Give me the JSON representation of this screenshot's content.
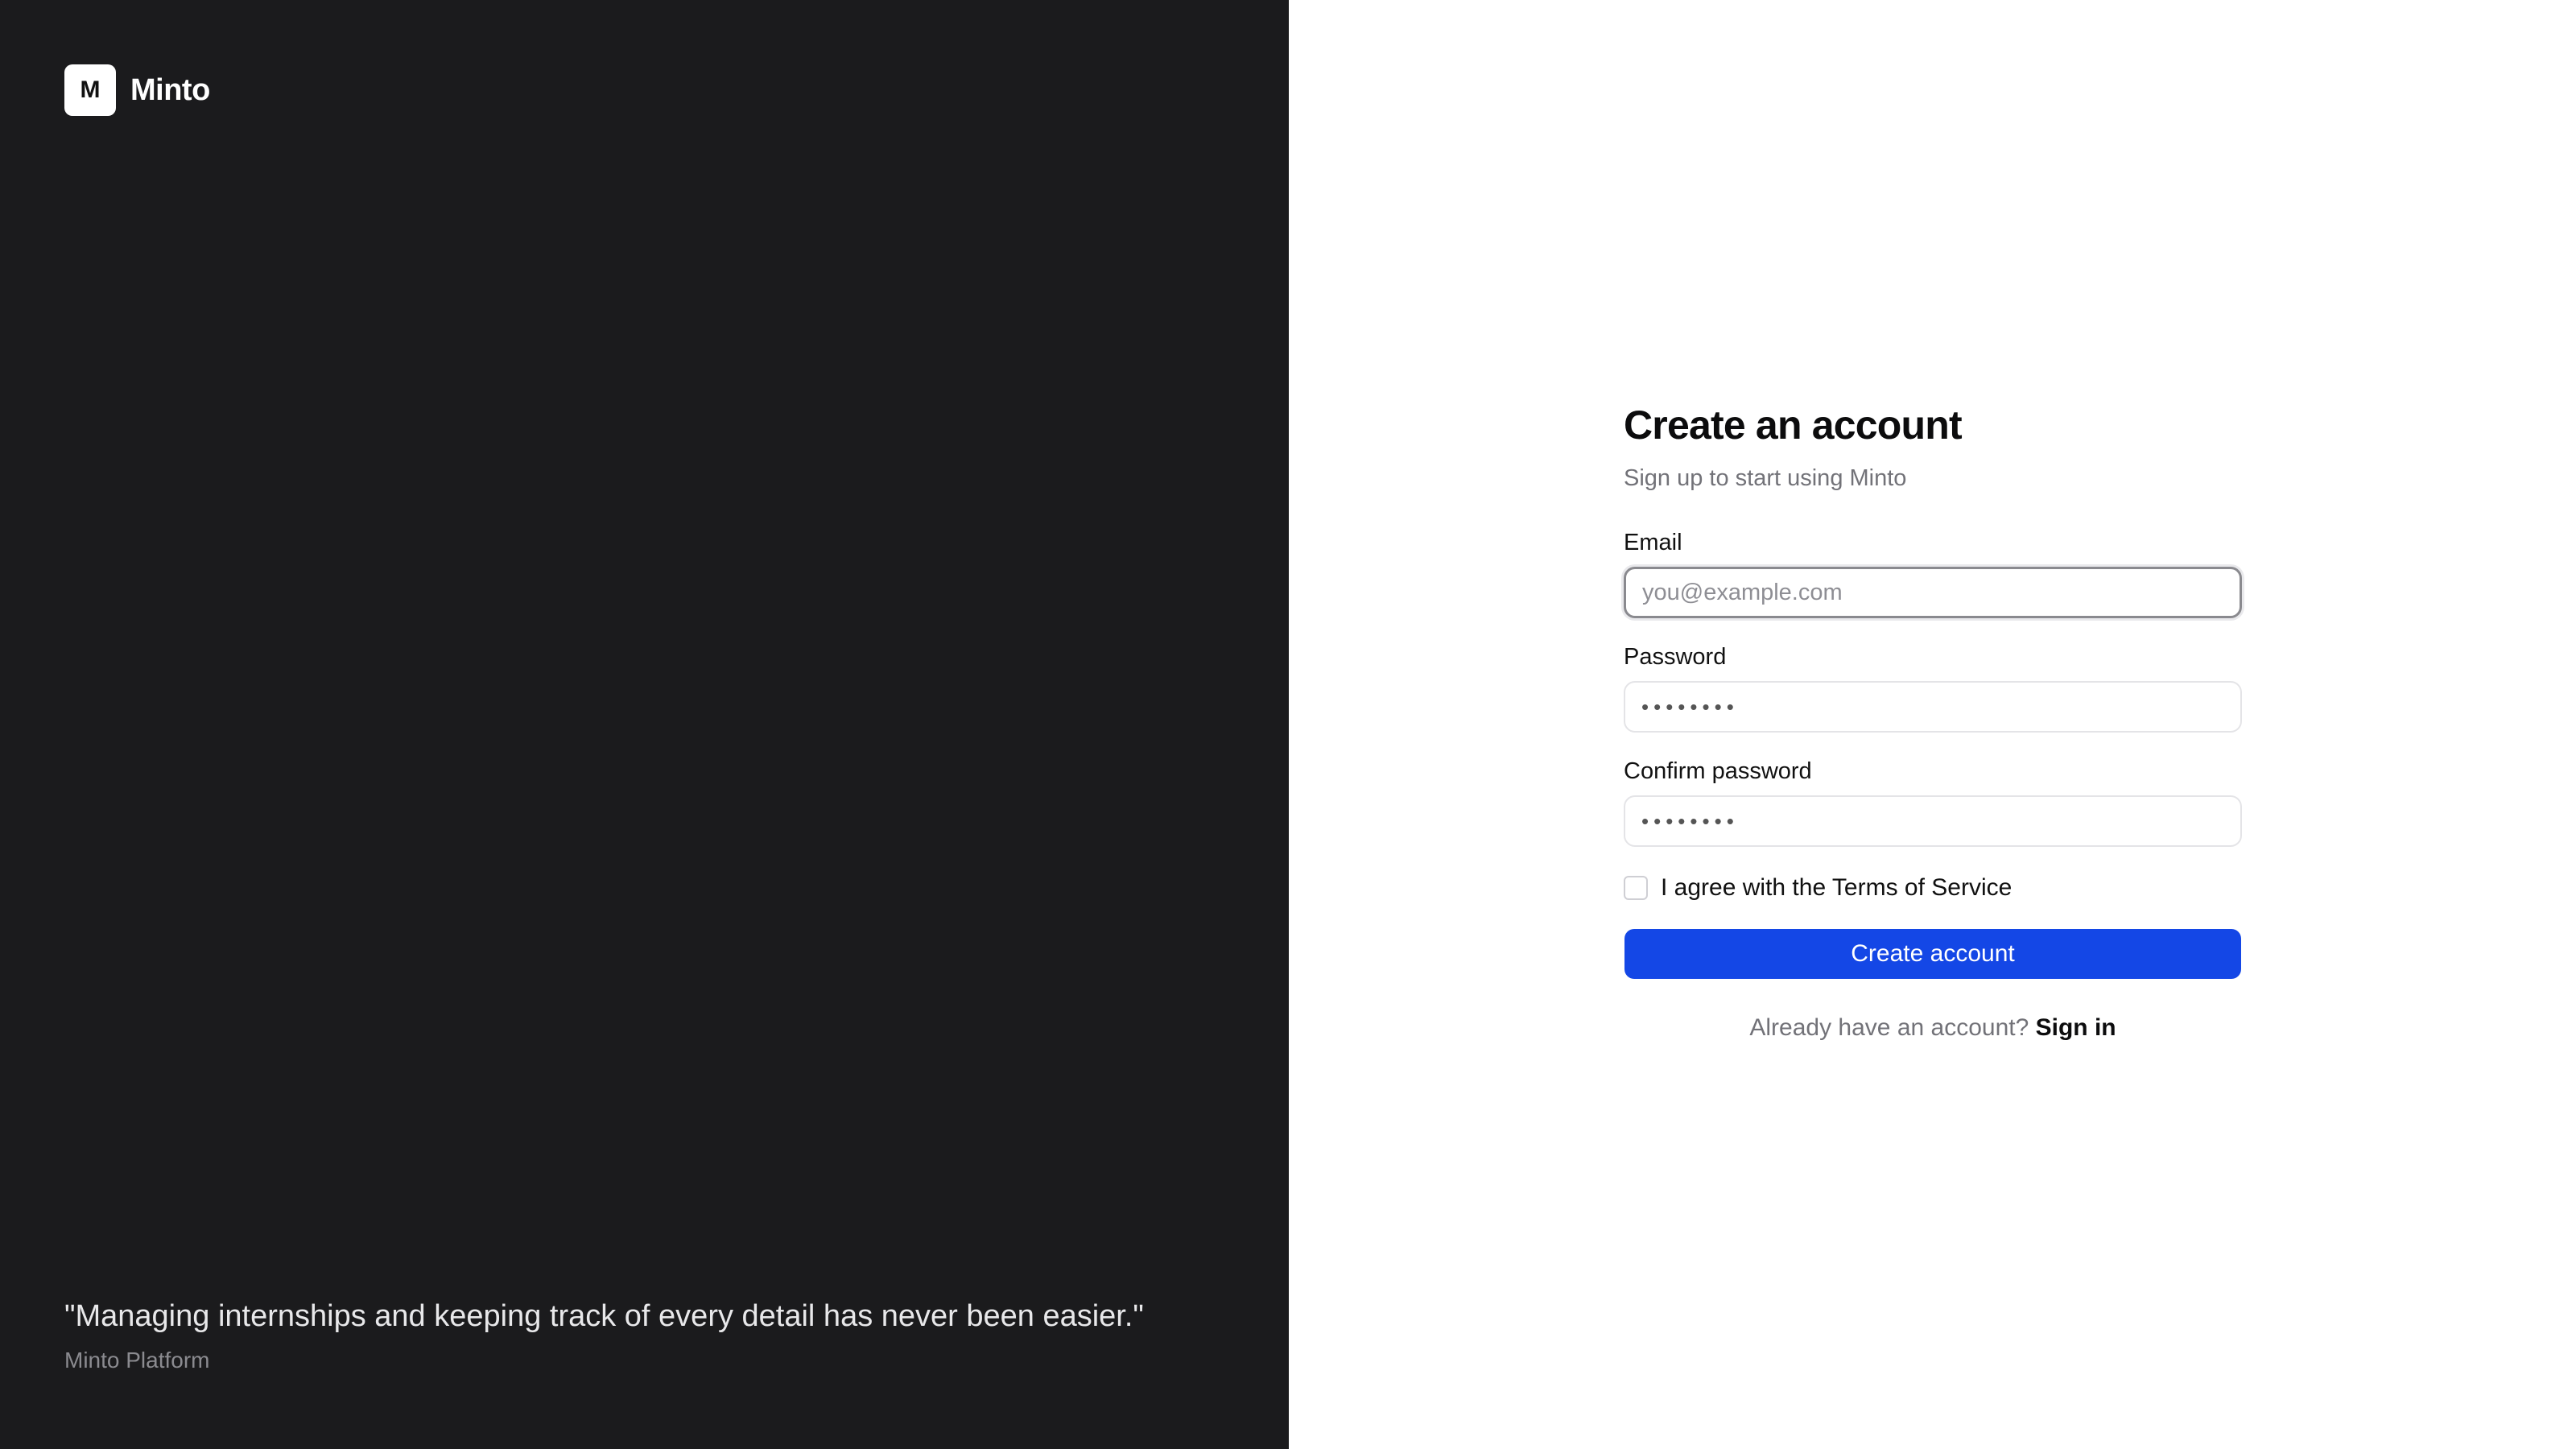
{
  "brand": {
    "logo_letter": "M",
    "name": "Minto",
    "quote": "\"Managing internships and keeping track of every detail has never been easier.\"",
    "quote_source": "Minto Platform",
    "panel_color": "#1b1b1d"
  },
  "form": {
    "title": "Create an account",
    "subtitle": "Sign up to start using Minto",
    "email": {
      "label": "Email",
      "placeholder": "you@example.com",
      "value": ""
    },
    "password": {
      "label": "Password",
      "masked_value": "••••••••"
    },
    "confirm_password": {
      "label": "Confirm password",
      "masked_value": "••••••••"
    },
    "terms": {
      "label": "I agree with the Terms of Service",
      "checked": false
    },
    "submit_label": "Create account",
    "signin_prompt": "Already have an account?",
    "signin_link": "Sign in",
    "accent_color": "#1447e6"
  }
}
